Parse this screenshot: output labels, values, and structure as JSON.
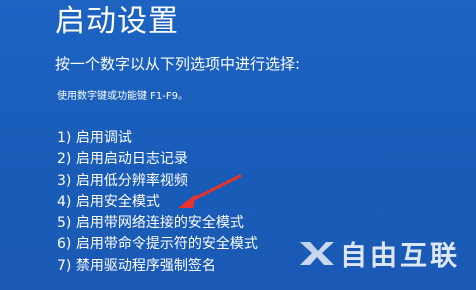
{
  "screen": {
    "title": "启动设置",
    "prompt": "按一个数字以从下列选项中进行选择:",
    "hint": "使用数字键或功能键 F1-F9。",
    "options": [
      "1) 启用调试",
      "2) 启用启动日志记录",
      "3) 启用低分辨率视频",
      "4) 启用安全模式",
      "5) 启用带网络连接的安全模式",
      "6) 启用带命令提示符的安全模式",
      "7) 禁用驱动程序强制签名"
    ]
  },
  "annotation": {
    "arrow_color": "#e8322b",
    "points_to": "4) 启用安全模式"
  },
  "watermark": {
    "text": "自由互联",
    "logo_icon": "x-logo-icon"
  },
  "colors": {
    "background": "#1a5dba",
    "text": "#ffffff"
  }
}
